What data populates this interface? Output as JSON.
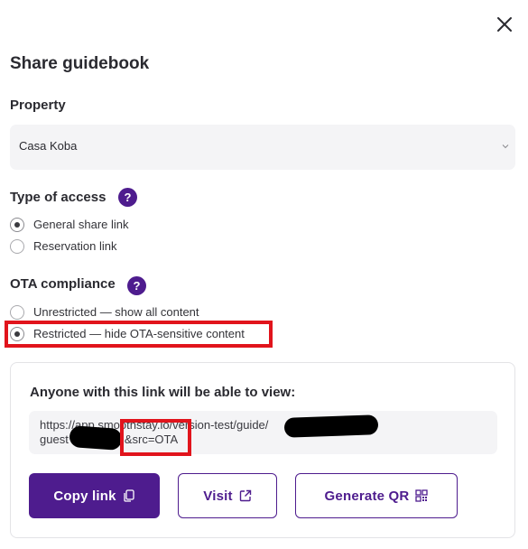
{
  "dialog": {
    "title": "Share guidebook"
  },
  "property": {
    "label": "Property",
    "selected": "Casa Koba"
  },
  "access": {
    "label": "Type of access",
    "help": "?",
    "options": [
      {
        "label": "General share link",
        "checked": true
      },
      {
        "label": "Reservation link",
        "checked": false
      }
    ]
  },
  "ota": {
    "label": "OTA compliance",
    "help": "?",
    "options": [
      {
        "label": "Unrestricted — show all content",
        "checked": false
      },
      {
        "label": "Restricted — hide OTA-sensitive content",
        "checked": true
      }
    ]
  },
  "share": {
    "heading": "Anyone with this link will be able to view:",
    "link_line1": "https://app.smoothstay.io/version-test/guide/",
    "link_line2_prefix": "guest",
    "link_line2_suffix": "&src=OTA",
    "buttons": {
      "copy": "Copy link",
      "visit": "Visit",
      "qr": "Generate QR"
    }
  },
  "colors": {
    "accent": "#4e1c8e",
    "highlight": "#e1141c"
  }
}
